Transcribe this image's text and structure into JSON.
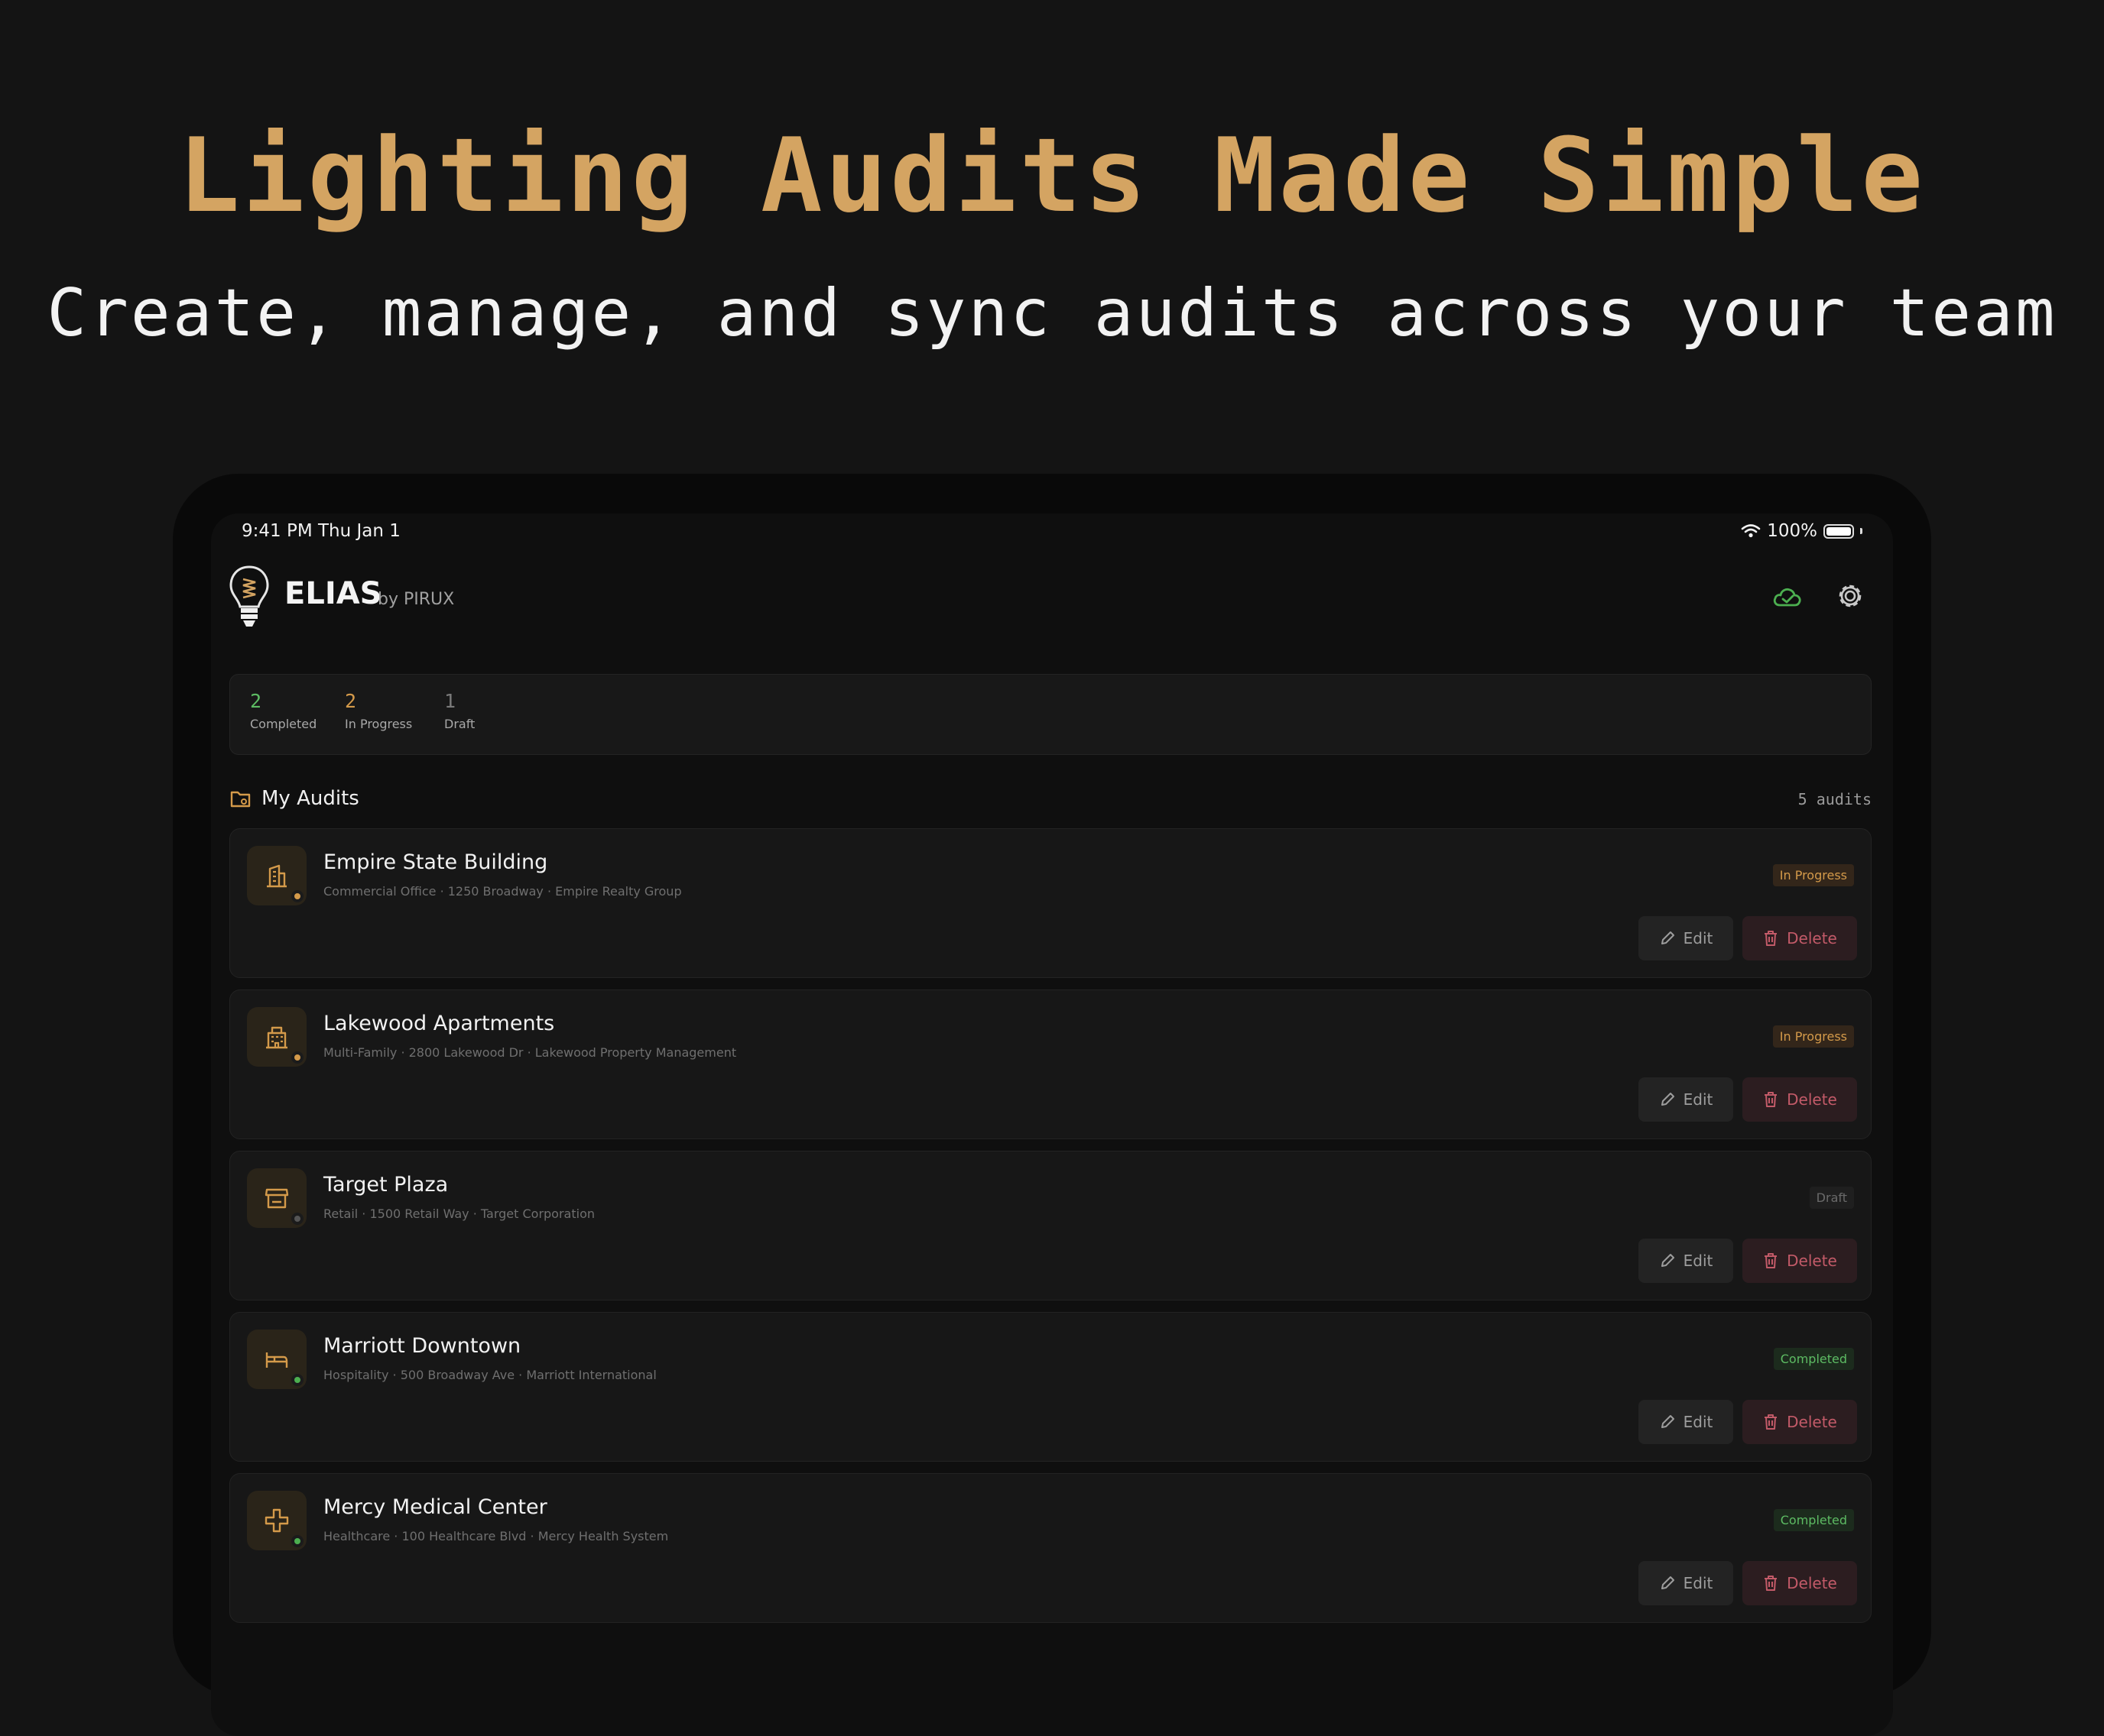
{
  "hero": {
    "title": "Lighting Audits Made Simple",
    "subtitle": "Create, manage, and sync audits across your team"
  },
  "status_bar": {
    "time": "9:41 PM",
    "date": "Thu Jan 1",
    "battery": "100%"
  },
  "app": {
    "name": "ELIAS",
    "by": "by PIRUX",
    "icons": [
      "bulb-logo-icon",
      "cloud-sync-icon",
      "gear-icon"
    ]
  },
  "stats": [
    {
      "value": "2",
      "label": "Completed",
      "color": "#5dbb63"
    },
    {
      "value": "2",
      "label": "In Progress",
      "color": "#d49a4a"
    },
    {
      "value": "1",
      "label": "Draft",
      "color": "#7a7a7a"
    }
  ],
  "section": {
    "title": "My Audits",
    "count": "5 audits"
  },
  "audits": [
    {
      "name": "Empire State Building",
      "details": "Commercial Office · 1250 Broadway · Empire Realty Group",
      "status": "In Progress",
      "icon": "office-building-icon"
    },
    {
      "name": "Lakewood Apartments",
      "details": "Multi-Family · 2800 Lakewood Dr · Lakewood Property Management",
      "status": "In Progress",
      "icon": "apartment-building-icon"
    },
    {
      "name": "Target Plaza",
      "details": "Retail · 1500 Retail Way · Target Corporation",
      "status": "Draft",
      "icon": "store-icon"
    },
    {
      "name": "Marriott Downtown",
      "details": "Hospitality · 500 Broadway Ave · Marriott International",
      "status": "Completed",
      "icon": "bed-icon"
    },
    {
      "name": "Mercy Medical Center",
      "details": "Healthcare · 100 Healthcare Blvd · Mercy Health System",
      "status": "Completed",
      "icon": "medical-cross-icon"
    }
  ],
  "actions": {
    "edit": "Edit",
    "delete": "Delete"
  },
  "colors": {
    "accent": "#d4a462",
    "background": "#141414",
    "card": "#171717",
    "danger": "#c25a68",
    "success": "#5dbb63"
  }
}
